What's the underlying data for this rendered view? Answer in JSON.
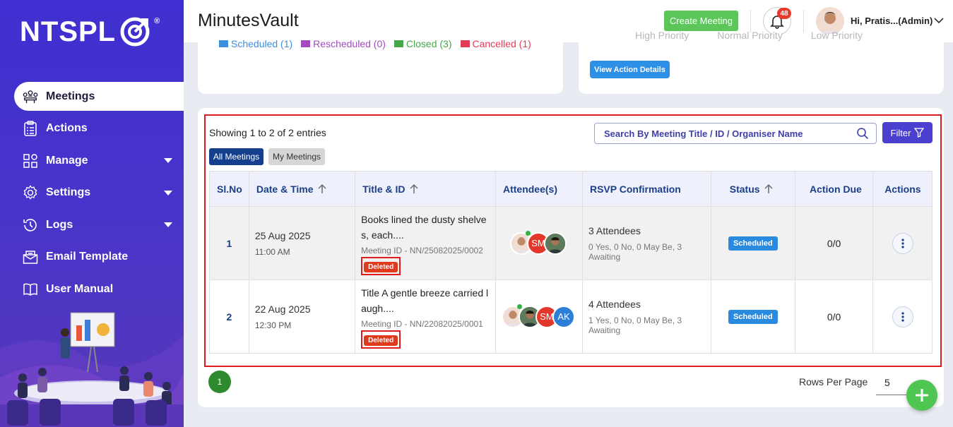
{
  "brand": {
    "logo_text": "NTSPL",
    "reg_mark": "®"
  },
  "sidebar": {
    "items": [
      {
        "label": "Meetings",
        "icon": "meeting-group-icon",
        "active": true
      },
      {
        "label": "Actions",
        "icon": "clipboard-list-icon"
      },
      {
        "label": "Manage",
        "icon": "grid-manage-icon",
        "has_caret": true
      },
      {
        "label": "Settings",
        "icon": "gear-icon",
        "has_caret": true
      },
      {
        "label": "Logs",
        "icon": "history-clock-icon",
        "has_caret": true
      },
      {
        "label": "Email Template",
        "icon": "envelope-icon"
      },
      {
        "label": "User Manual",
        "icon": "book-icon"
      }
    ]
  },
  "header": {
    "app_title": "MinutesVault",
    "create_meeting_label": "Create Meeting",
    "notification_count": "48",
    "user_name": "Hi, Pratis...(Admin)"
  },
  "top_cards": {
    "legend": [
      {
        "label": "Scheduled (1)",
        "color": "#3d8fe0"
      },
      {
        "label": "Rescheduled (0)",
        "color": "#a44bbf"
      },
      {
        "label": "Closed (3)",
        "color": "#46a84a"
      },
      {
        "label": "Cancelled (1)",
        "color": "#e33b5a"
      }
    ],
    "priorities": [
      "High Priority",
      "Normal Priority",
      "Low Priority"
    ],
    "view_action_details_label": "View Action Details"
  },
  "list": {
    "showing_text": "Showing 1 to 2 of 2 entries",
    "search_placeholder": "Search By Meeting Title / ID / Organiser Name",
    "filter_label": "Filter",
    "tab_all": "All Meetings",
    "tab_my": "My Meetings",
    "columns": [
      "Sl.No",
      "Date & Time",
      "Title & ID",
      "Attendee(s)",
      "RSVP Confirmation",
      "Status",
      "Action Due",
      "Actions"
    ],
    "rows": [
      {
        "sl": "1",
        "date": "25 Aug 2025",
        "time": "11:00 AM",
        "title": "Books lined the dusty shelves, each....",
        "meeting_id": "Meeting ID - NN/25082025/0002",
        "deleted_label": "Deleted",
        "attendees": [
          "photo-female",
          "SM",
          "photo-male"
        ],
        "rsvp_count": "3 Attendees",
        "rsvp_detail": "0 Yes, 0 No, 0 May Be, 3 Awaiting",
        "status": "Scheduled",
        "action_due": "0/0"
      },
      {
        "sl": "2",
        "date": "22 Aug 2025",
        "time": "12:30 PM",
        "title": "Title A gentle breeze carried laugh....",
        "meeting_id": "Meeting ID - NN/22082025/0001",
        "deleted_label": "Deleted",
        "attendees": [
          "photo-female",
          "photo-male",
          "SM",
          "AK"
        ],
        "rsvp_count": "4 Attendees",
        "rsvp_detail": "1 Yes, 0 No, 0 May Be, 3 Awaiting",
        "status": "Scheduled",
        "action_due": "0/0"
      }
    ],
    "current_page": "1",
    "rows_per_page_label": "Rows Per Page",
    "rows_per_page_value": "5"
  },
  "colors": {
    "sidebar": "#4232cc",
    "accent_green": "#5cc65a",
    "header_blue": "#1b3f87",
    "deleted_red": "#e0391c",
    "scheduled_blue": "#2a8ae0"
  }
}
